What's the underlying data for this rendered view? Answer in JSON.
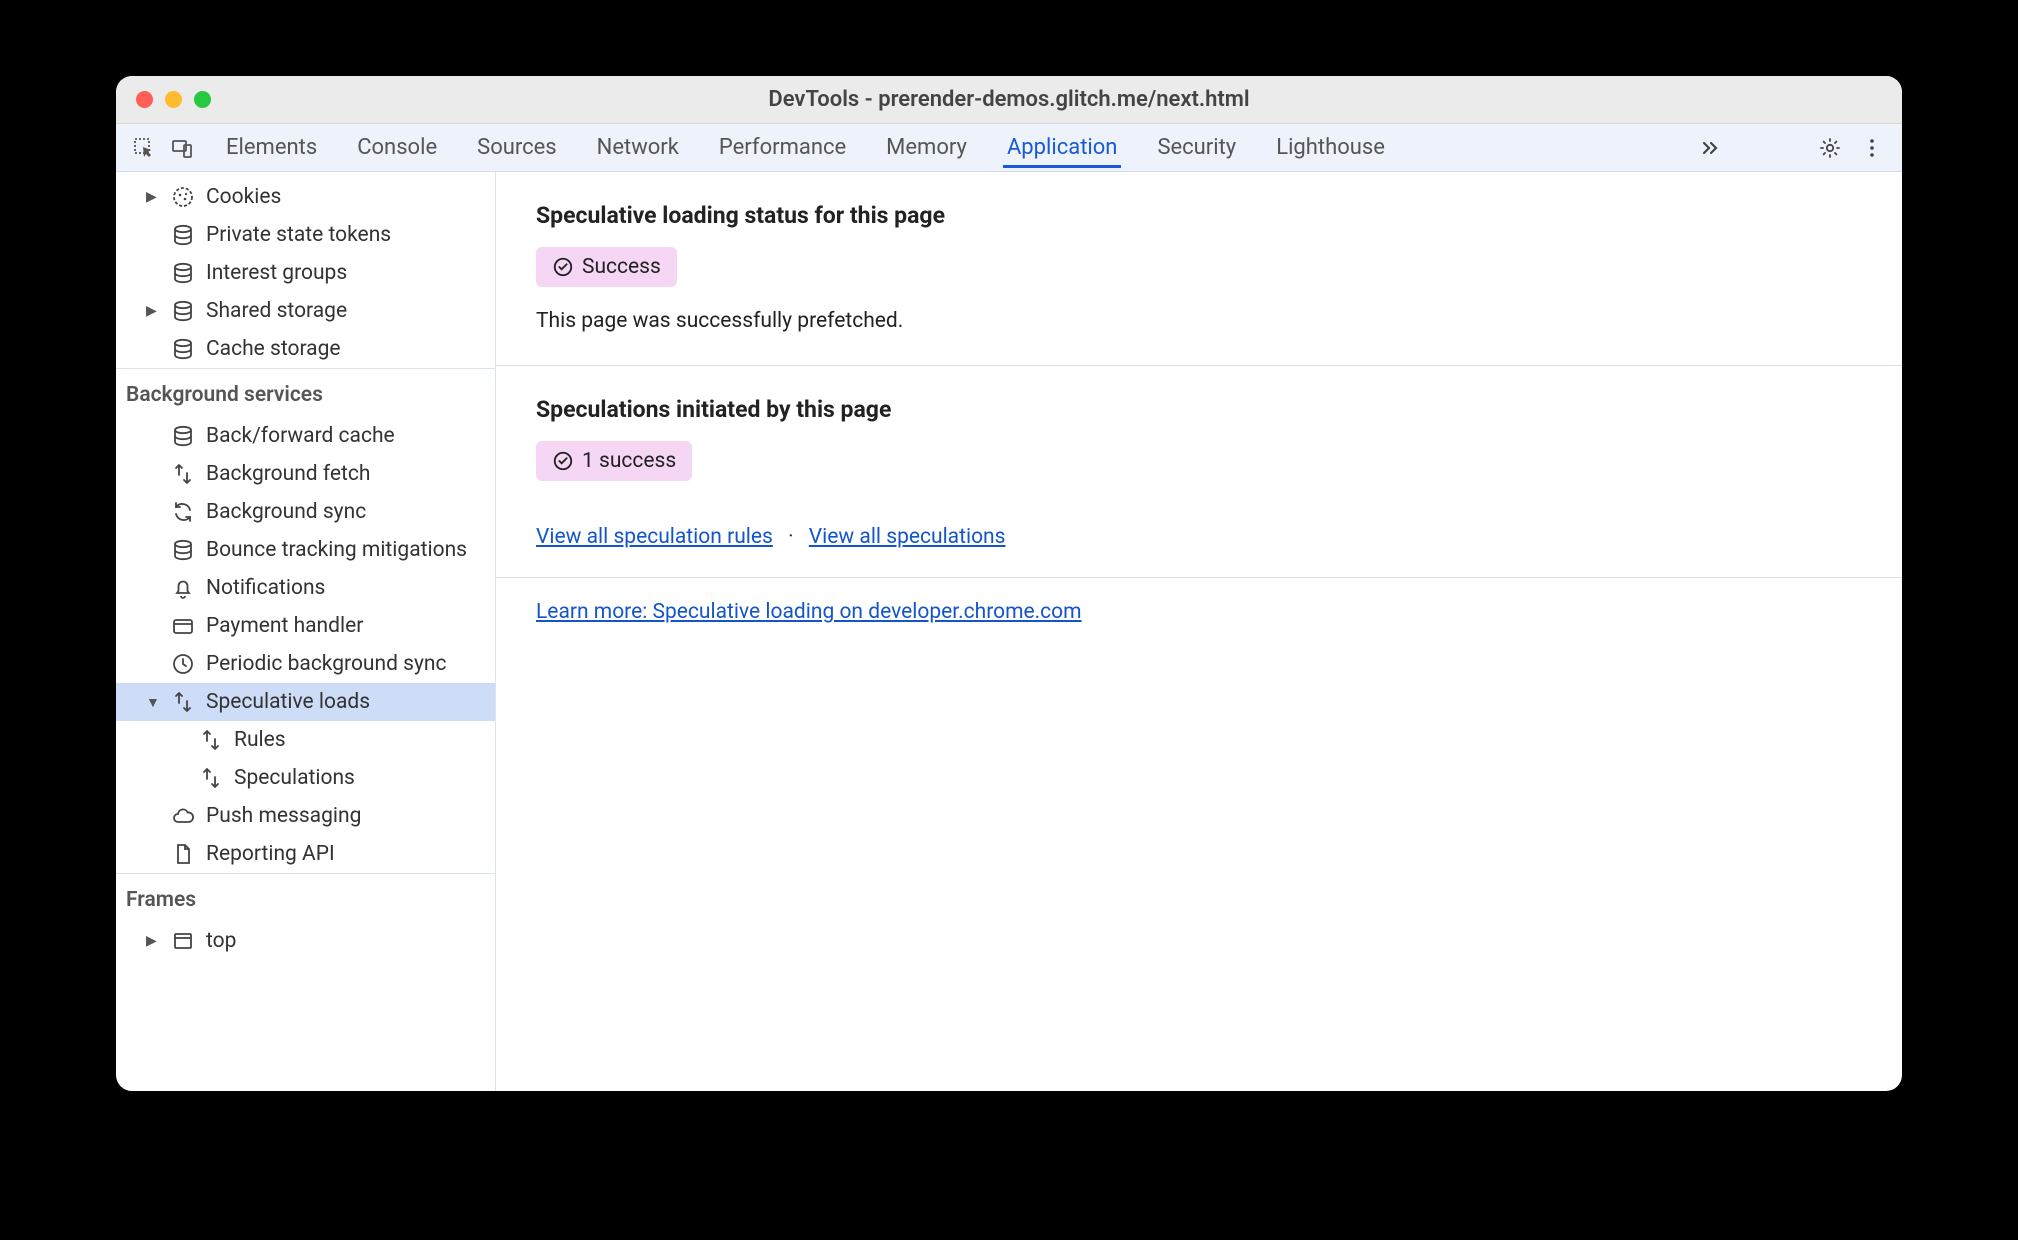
{
  "window": {
    "title": "DevTools - prerender-demos.glitch.me/next.html"
  },
  "tabs": [
    {
      "label": "Elements"
    },
    {
      "label": "Console"
    },
    {
      "label": "Sources"
    },
    {
      "label": "Network"
    },
    {
      "label": "Performance"
    },
    {
      "label": "Memory"
    },
    {
      "label": "Application",
      "active": true
    },
    {
      "label": "Security"
    },
    {
      "label": "Lighthouse"
    }
  ],
  "sidebar": {
    "storage": [
      {
        "label": "Cookies",
        "icon": "cookie",
        "arrow": true
      },
      {
        "label": "Private state tokens",
        "icon": "db"
      },
      {
        "label": "Interest groups",
        "icon": "db"
      },
      {
        "label": "Shared storage",
        "icon": "db",
        "arrow": true
      },
      {
        "label": "Cache storage",
        "icon": "db"
      }
    ],
    "bg_header": "Background services",
    "bg": [
      {
        "label": "Back/forward cache",
        "icon": "db"
      },
      {
        "label": "Background fetch",
        "icon": "fetch"
      },
      {
        "label": "Background sync",
        "icon": "sync"
      },
      {
        "label": "Bounce tracking mitigations",
        "icon": "db"
      },
      {
        "label": "Notifications",
        "icon": "bell"
      },
      {
        "label": "Payment handler",
        "icon": "card"
      },
      {
        "label": "Periodic background sync",
        "icon": "clock"
      },
      {
        "label": "Speculative loads",
        "icon": "fetch",
        "arrow": "down",
        "selected": true
      },
      {
        "label": "Rules",
        "icon": "fetch",
        "child": true
      },
      {
        "label": "Speculations",
        "icon": "fetch",
        "child": true
      },
      {
        "label": "Push messaging",
        "icon": "cloud"
      },
      {
        "label": "Reporting API",
        "icon": "file"
      }
    ],
    "frames_header": "Frames",
    "frames": [
      {
        "label": "top",
        "icon": "frame",
        "arrow": true
      }
    ]
  },
  "main": {
    "section1": {
      "heading": "Speculative loading status for this page",
      "badge": "Success",
      "desc": "This page was successfully prefetched."
    },
    "section2": {
      "heading": "Speculations initiated by this page",
      "badge": "1 success",
      "link1": "View all speculation rules",
      "link2": "View all speculations"
    },
    "learn": "Learn more: Speculative loading on developer.chrome.com"
  }
}
